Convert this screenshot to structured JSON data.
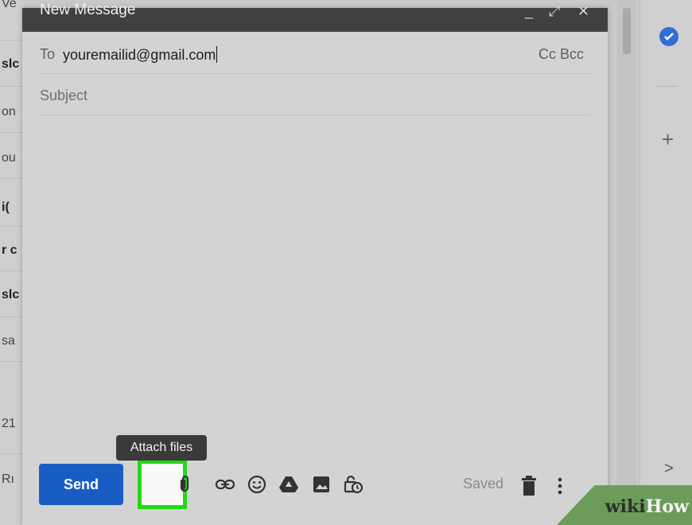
{
  "compose": {
    "title": "New Message",
    "minimize": "_",
    "expand": "⤢",
    "close": "✕",
    "to_label": "To",
    "to_value": "youremailid@gmail.com",
    "cc_bcc": "Cc Bcc",
    "subject_placeholder": "Subject"
  },
  "toolbar": {
    "send_label": "Send",
    "tooltip": "Attach files",
    "saved_label": "Saved",
    "more": "⋮"
  },
  "left_list": {
    "rows": [
      "Ve",
      "slc",
      "on",
      "ou",
      "i(",
      "r c",
      "slc",
      "sa",
      "21",
      "Rı"
    ]
  },
  "side_panel": {
    "plus": "+",
    "chevron": ">"
  },
  "watermark": {
    "part1": "wiki",
    "part2": "How"
  },
  "colors": {
    "send_button": "#1a5dc2",
    "highlight_border": "#23d813",
    "header_bg": "#404040"
  }
}
